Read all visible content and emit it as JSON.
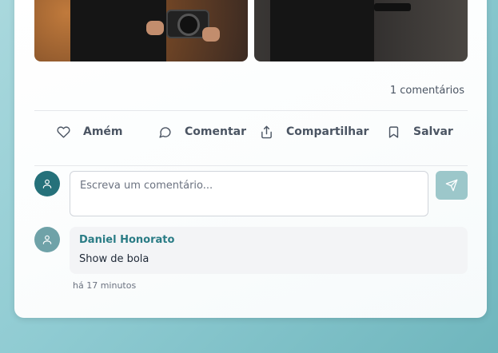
{
  "post": {
    "comment_count": "1 comentários"
  },
  "actions": {
    "like_label": "Amém",
    "comment_label": "Comentar",
    "share_label": "Compartilhar",
    "save_label": "Salvar"
  },
  "comment_form": {
    "placeholder": "Escreva um comentário..."
  },
  "comments": [
    {
      "author": "Daniel Honorato",
      "text": "Show de bola",
      "time": "há 17 minutos"
    }
  ],
  "icons": {
    "like": "heart-icon",
    "comment": "message-circle-icon",
    "share": "share-icon",
    "save": "bookmark-icon",
    "send": "send-icon",
    "avatar": "user-icon"
  },
  "colors": {
    "accent": "#2a7c85",
    "send_button": "#9cc7ca",
    "avatar_me": "#25717a",
    "avatar_other": "#6fa2a8"
  }
}
